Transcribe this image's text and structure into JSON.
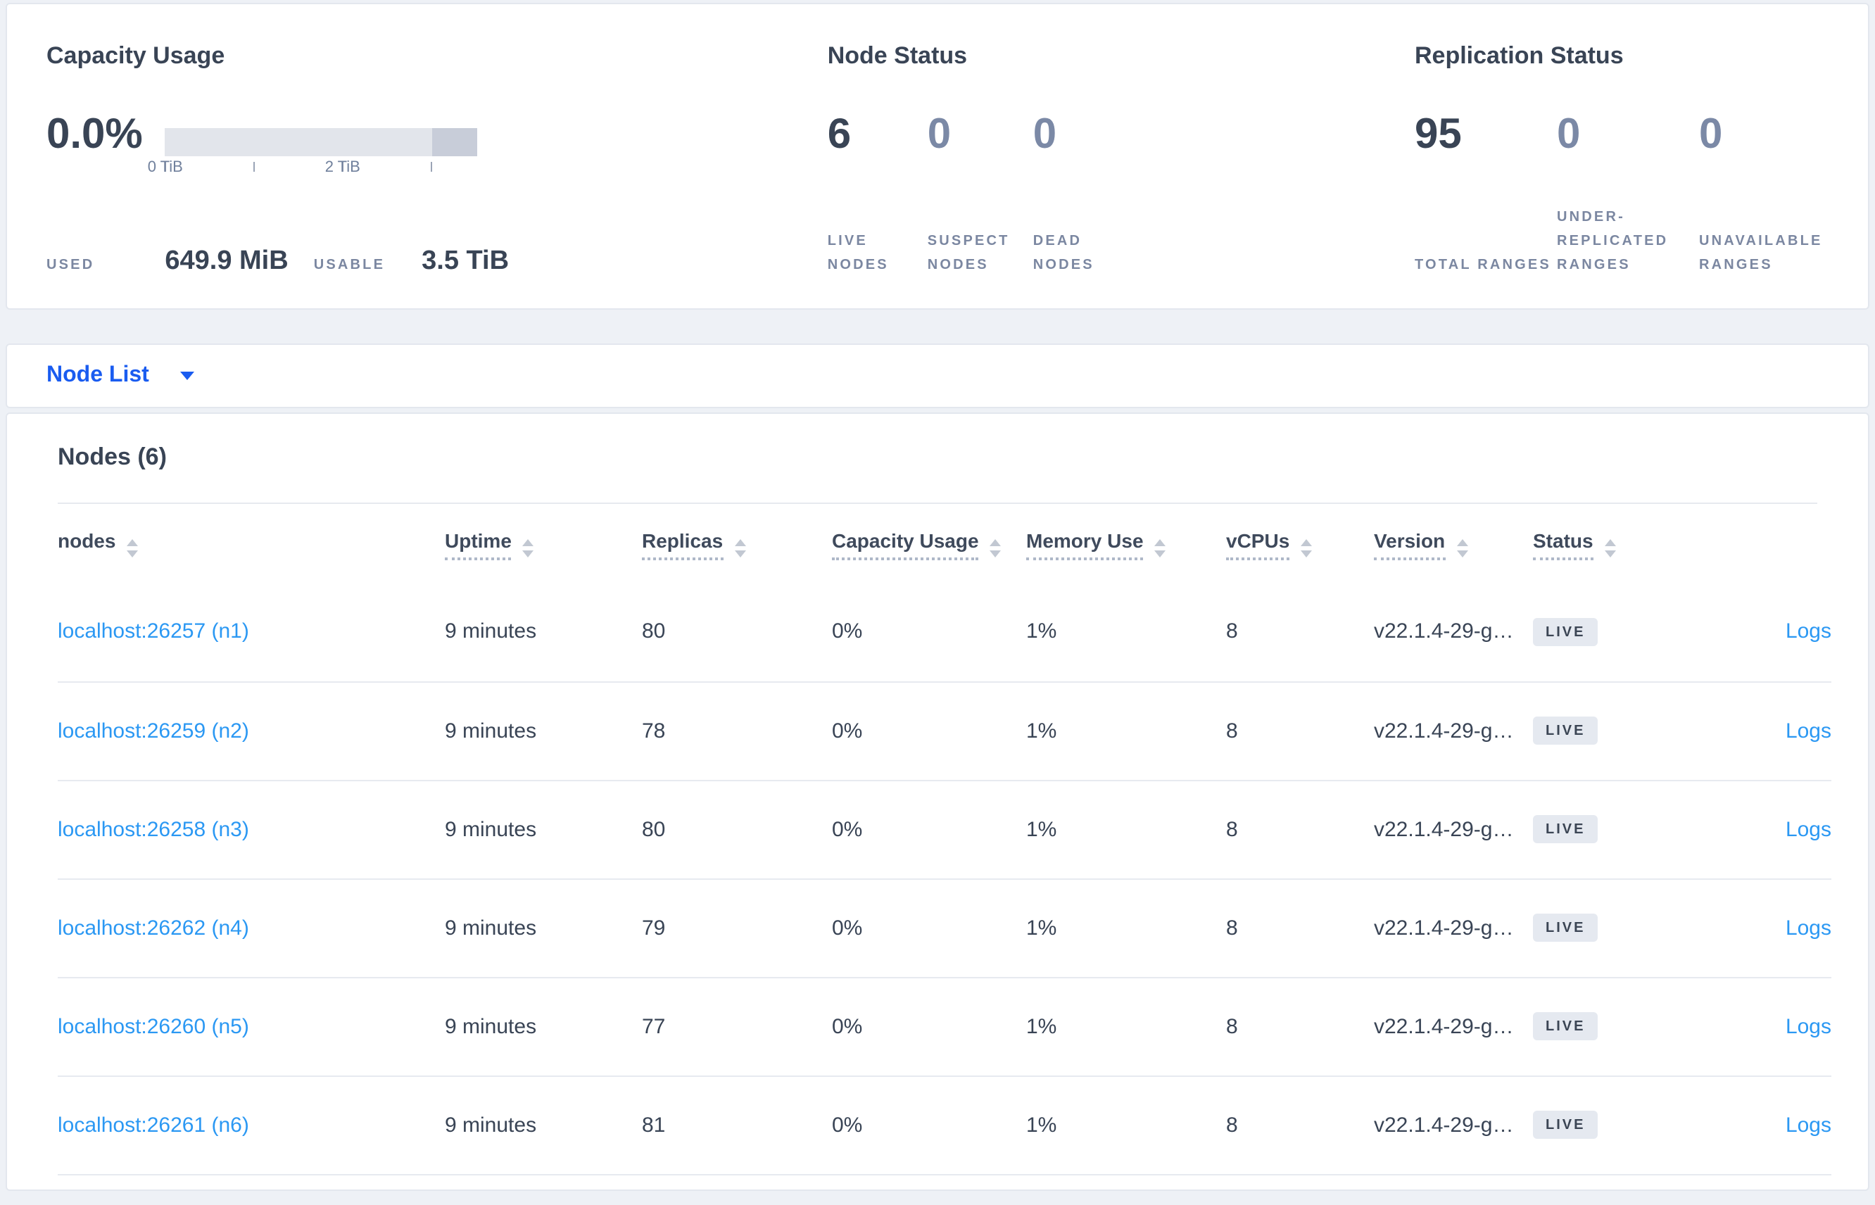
{
  "colors": {
    "accent_blue": "#1a5cf0",
    "link_blue": "#2b98f3",
    "text_dark": "#394455",
    "text_muted": "#7b87a1",
    "badge_bg": "#e5e9f0",
    "bar_track": "#e2e5eb",
    "bar_segment": "#c8cdd9"
  },
  "summary": {
    "capacity": {
      "title": "Capacity Usage",
      "percent": "0.0%",
      "used_label": "USED",
      "used_value": "649.9 MiB",
      "usable_label": "USABLE",
      "usable_value": "3.5 TiB",
      "tick_labels": [
        "0 TiB",
        "2 TiB"
      ],
      "bar_segment_pct": 14.8
    },
    "node_status": {
      "title": "Node Status",
      "metrics": [
        {
          "value": "6",
          "label": "LIVE NODES",
          "emphasis": true
        },
        {
          "value": "0",
          "label": "SUSPECT NODES",
          "emphasis": false
        },
        {
          "value": "0",
          "label": "DEAD NODES",
          "emphasis": false
        }
      ]
    },
    "replication": {
      "title": "Replication Status",
      "metrics": [
        {
          "value": "95",
          "label": "TOTAL RANGES",
          "emphasis": true
        },
        {
          "value": "0",
          "label": "UNDER-REPLICATED RANGES",
          "emphasis": false
        },
        {
          "value": "0",
          "label": "UNAVAILABLE RANGES",
          "emphasis": false
        }
      ]
    }
  },
  "view_selector": {
    "label": "Node List"
  },
  "nodes_section": {
    "title": "Nodes (6)",
    "columns": [
      {
        "label": "nodes",
        "key": "address",
        "underline": false,
        "sortable": true
      },
      {
        "label": "Uptime",
        "key": "uptime",
        "underline": true,
        "sortable": true
      },
      {
        "label": "Replicas",
        "key": "replicas",
        "underline": true,
        "sortable": true
      },
      {
        "label": "Capacity Usage",
        "key": "capacity",
        "underline": true,
        "sortable": true
      },
      {
        "label": "Memory Use",
        "key": "memory",
        "underline": true,
        "sortable": true
      },
      {
        "label": "vCPUs",
        "key": "vcpus",
        "underline": true,
        "sortable": true
      },
      {
        "label": "Version",
        "key": "version",
        "underline": true,
        "sortable": true
      },
      {
        "label": "Status",
        "key": "status",
        "underline": true,
        "sortable": true
      },
      {
        "label": "",
        "key": "logs",
        "underline": false,
        "sortable": false
      }
    ],
    "rows": [
      {
        "address": "localhost:26257 (n1)",
        "uptime": "9 minutes",
        "replicas": "80",
        "capacity": "0%",
        "memory": "1%",
        "vcpus": "8",
        "version": "v22.1.4-29-g…",
        "status": "LIVE",
        "logs": "Logs"
      },
      {
        "address": "localhost:26259 (n2)",
        "uptime": "9 minutes",
        "replicas": "78",
        "capacity": "0%",
        "memory": "1%",
        "vcpus": "8",
        "version": "v22.1.4-29-g…",
        "status": "LIVE",
        "logs": "Logs"
      },
      {
        "address": "localhost:26258 (n3)",
        "uptime": "9 minutes",
        "replicas": "80",
        "capacity": "0%",
        "memory": "1%",
        "vcpus": "8",
        "version": "v22.1.4-29-g…",
        "status": "LIVE",
        "logs": "Logs"
      },
      {
        "address": "localhost:26262 (n4)",
        "uptime": "9 minutes",
        "replicas": "79",
        "capacity": "0%",
        "memory": "1%",
        "vcpus": "8",
        "version": "v22.1.4-29-g…",
        "status": "LIVE",
        "logs": "Logs"
      },
      {
        "address": "localhost:26260 (n5)",
        "uptime": "9 minutes",
        "replicas": "77",
        "capacity": "0%",
        "memory": "1%",
        "vcpus": "8",
        "version": "v22.1.4-29-g…",
        "status": "LIVE",
        "logs": "Logs"
      },
      {
        "address": "localhost:26261 (n6)",
        "uptime": "9 minutes",
        "replicas": "81",
        "capacity": "0%",
        "memory": "1%",
        "vcpus": "8",
        "version": "v22.1.4-29-g…",
        "status": "LIVE",
        "logs": "Logs"
      }
    ]
  }
}
